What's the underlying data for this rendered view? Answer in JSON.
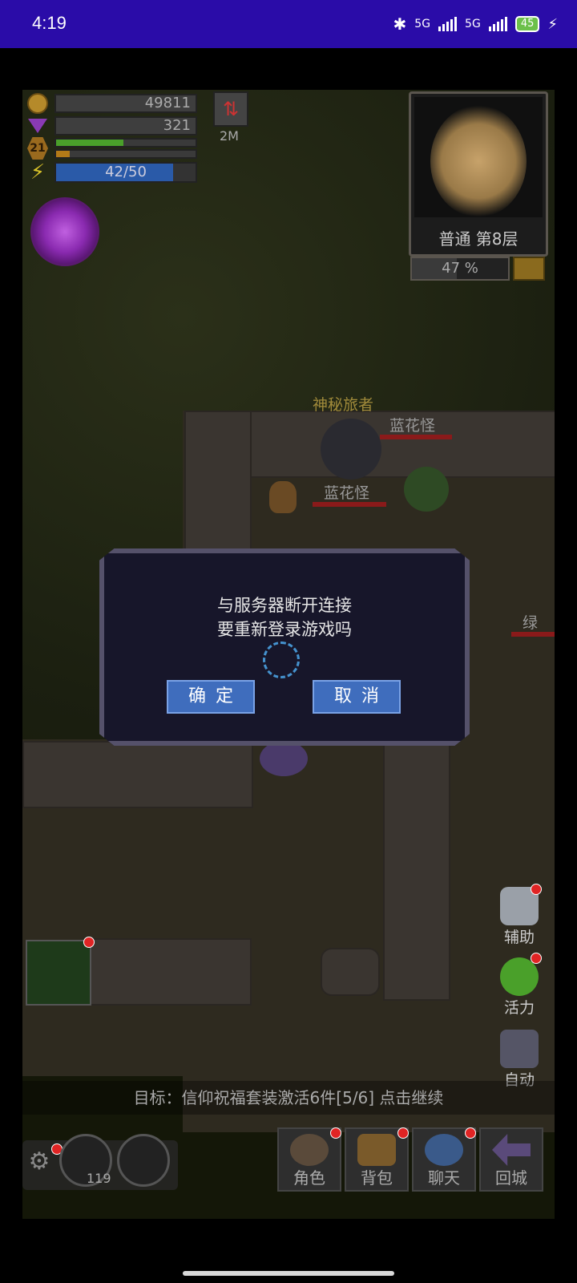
{
  "status_bar": {
    "time": "4:19",
    "network1": "5G",
    "network2": "5G",
    "battery": "45"
  },
  "hud": {
    "gold": "49811",
    "gems": "321",
    "level": "21",
    "xp_fill_fraction": 0.5,
    "energy": "42/50",
    "energy_fill_fraction": 0.84,
    "speed_label": "2M"
  },
  "minimap": {
    "floor_name": "普通 第8层",
    "explore_percent": "47 %",
    "explore_fraction": 0.47
  },
  "scene": {
    "npc_name": "神秘旅者",
    "monster1_name": "蓝花怪",
    "monster2_name": "蓝花怪",
    "monster3_name": "绿"
  },
  "dialog": {
    "line1": "与服务器断开连接",
    "line2": "要重新登录游戏吗",
    "confirm_label": "确定",
    "cancel_label": "取消"
  },
  "side_buttons": {
    "assist": "辅助",
    "vitality": "活力",
    "auto": "自动"
  },
  "target_text": "目标：信仰祝福套装激活6件[5/6]   点击继续",
  "quick_slot_count": "119",
  "menu": {
    "character": "角色",
    "bag": "背包",
    "chat": "聊天",
    "return_city": "回城"
  },
  "colors": {
    "status_bar": "#2a0ca8",
    "button_blue": "#3f6dbd",
    "notification_red": "#e02424"
  }
}
